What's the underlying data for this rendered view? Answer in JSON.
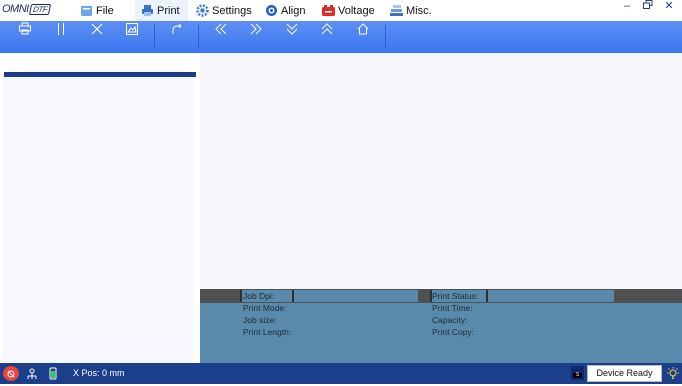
{
  "app": {
    "logo_text": "OMNI",
    "logo_suffix": "DTF"
  },
  "menu": {
    "items": [
      {
        "label": "File",
        "icon": "file-icon"
      },
      {
        "label": "Print",
        "icon": "printer-icon",
        "active": true
      },
      {
        "label": "Settings",
        "icon": "gear-icon"
      },
      {
        "label": "Align",
        "icon": "target-icon"
      },
      {
        "label": "Voltage",
        "icon": "battery-icon"
      },
      {
        "label": "Misc.",
        "icon": "stack-icon"
      }
    ]
  },
  "window_controls": [
    "minimize",
    "restore",
    "close"
  ],
  "toolbar": {
    "buttons": [
      {
        "name": "print",
        "icon": "printer-icon"
      },
      {
        "name": "pause",
        "icon": "pause-icon"
      },
      {
        "name": "cancel",
        "icon": "close-icon"
      },
      {
        "name": "image",
        "icon": "image-icon"
      },
      {
        "name": "redo",
        "icon": "redo-icon"
      },
      {
        "name": "move-left",
        "icon": "double-chevron-left-icon"
      },
      {
        "name": "move-right",
        "icon": "double-chevron-right-icon"
      },
      {
        "name": "move-down",
        "icon": "double-chevron-down-icon"
      },
      {
        "name": "move-up",
        "icon": "double-chevron-up-icon"
      },
      {
        "name": "home",
        "icon": "home-icon"
      }
    ]
  },
  "job_info": {
    "left": [
      "Job Dpi:",
      "Print Mode:",
      "Job size:",
      "Print Length:"
    ],
    "right": [
      "Print Status:",
      "Print Time:",
      "Capacity:",
      "Print Copy:"
    ]
  },
  "status": {
    "x_pos": "X Pos: 0 mm",
    "device": "Device Ready",
    "mini_label": "S"
  },
  "colors": {
    "toolbar": "#3b78f0",
    "status_bar": "#1c3f8c",
    "info_panel": "#5a8aab",
    "accent_dark": "#1b3a8a"
  }
}
